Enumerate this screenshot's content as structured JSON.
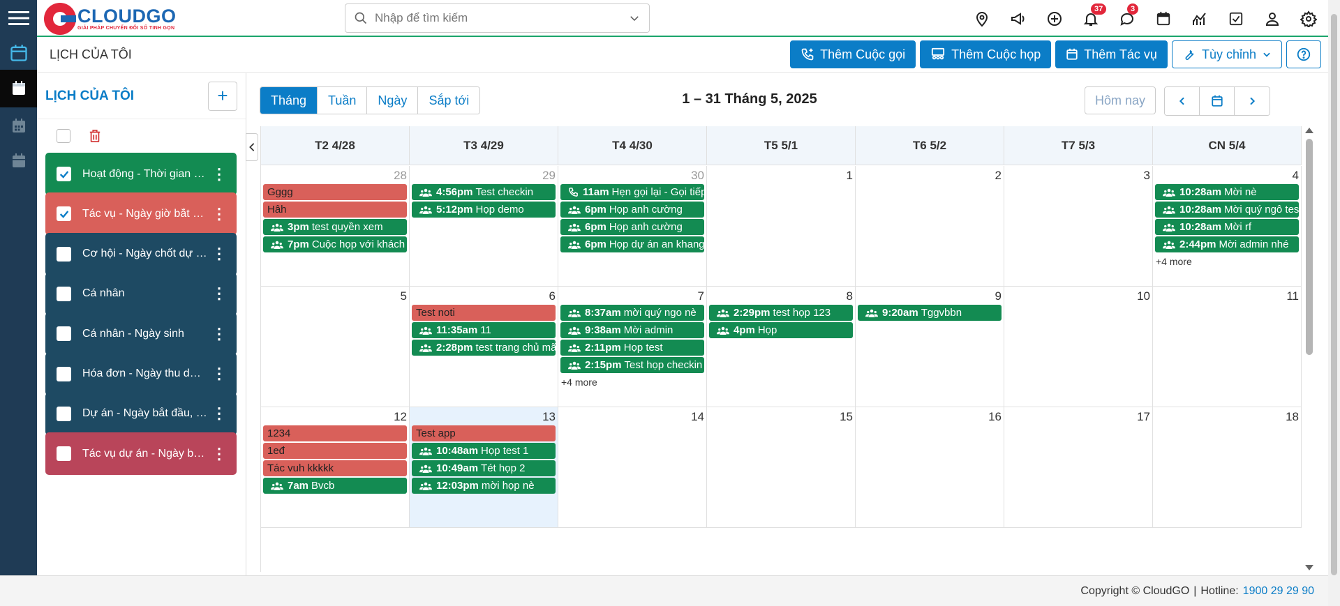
{
  "app": {
    "brand": "CLOUDGO",
    "tagline": "GIẢI PHÁP CHUYỂN ĐỔI SỐ TINH GỌN"
  },
  "search": {
    "placeholder": "Nhập để tìm kiếm"
  },
  "notifications": {
    "bell_count": "37",
    "chat_count": "3"
  },
  "page_title": "LỊCH CỦA TÔI",
  "actions": {
    "call": "Thêm Cuộc gọi",
    "meeting": "Thêm Cuộc họp",
    "task": "Thêm Tác vụ",
    "customize": "Tùy chỉnh"
  },
  "left_panel": {
    "title": "LỊCH CỦA TÔI",
    "calendars": [
      {
        "name": "Hoạt động - Thời gian bắt đầu",
        "color": "#138b52",
        "checked": true
      },
      {
        "name": "Tác vụ - Ngày giờ bắt đầu",
        "color": "#d9605a",
        "checked": true
      },
      {
        "name": "Cơ hội - Ngày chốt dự kiến",
        "color": "#1e4a63",
        "checked": false
      },
      {
        "name": "Cá nhân",
        "color": "#1e4a63",
        "checked": false
      },
      {
        "name": "Cá nhân - Ngày sinh",
        "color": "#1e4a63",
        "checked": false
      },
      {
        "name": "Hóa đơn - Ngày thu dự kiến",
        "color": "#1e4a63",
        "checked": false
      },
      {
        "name": "Dự án - Ngày bắt đầu, kết thúc",
        "color": "#1e4a63",
        "checked": false
      },
      {
        "name": "Tác vụ dự án - Ngày bắt đầu",
        "color": "#b9455a",
        "checked": false
      }
    ]
  },
  "calendar": {
    "views": [
      "Tháng",
      "Tuần",
      "Ngày",
      "Sắp tới"
    ],
    "active_view": "Tháng",
    "range_title": "1 – 31 Tháng 5, 2025",
    "today_label": "Hôm nay",
    "day_headers": [
      "T2 4/28",
      "T3 4/29",
      "T4 4/30",
      "T5 5/1",
      "T6 5/2",
      "T7 5/3",
      "CN 5/4"
    ],
    "weeks": [
      {
        "days": [
          {
            "num": "28",
            "other": true,
            "events": [
              {
                "type": "task",
                "title": "Gggg"
              },
              {
                "type": "task",
                "title": "Hâh"
              },
              {
                "type": "meet",
                "time": "3pm",
                "title": "test quyền xem"
              },
              {
                "type": "meet",
                "time": "7pm",
                "title": "Cuộc họp với khách"
              }
            ]
          },
          {
            "num": "29",
            "other": true,
            "events": [
              {
                "type": "meet",
                "time": "4:56pm",
                "title": "Test checkin"
              },
              {
                "type": "meet",
                "time": "5:12pm",
                "title": "Họp demo"
              }
            ]
          },
          {
            "num": "30",
            "other": true,
            "events": [
              {
                "type": "call",
                "time": "11am",
                "title": "Hẹn gọi lại - Gọi tiếp"
              },
              {
                "type": "meet",
                "time": "6pm",
                "title": "Họp anh cường"
              },
              {
                "type": "meet",
                "time": "6pm",
                "title": "Họp anh cường"
              },
              {
                "type": "meet",
                "time": "6pm",
                "title": "Họp dự án an khang"
              }
            ]
          },
          {
            "num": "1",
            "events": []
          },
          {
            "num": "2",
            "events": []
          },
          {
            "num": "3",
            "events": []
          },
          {
            "num": "4",
            "events": [
              {
                "type": "meet",
                "time": "10:28am",
                "title": "Mời nè"
              },
              {
                "type": "meet",
                "time": "10:28am",
                "title": "Mời quý ngô test"
              },
              {
                "type": "meet",
                "time": "10:28am",
                "title": "Mời rf"
              },
              {
                "type": "meet",
                "time": "2:44pm",
                "title": "Mời admin nhé"
              }
            ],
            "more": "+4 more"
          }
        ]
      },
      {
        "days": [
          {
            "num": "5",
            "events": []
          },
          {
            "num": "6",
            "events": [
              {
                "type": "task",
                "title": "Test noti"
              },
              {
                "type": "meet",
                "time": "11:35am",
                "title": "11"
              },
              {
                "type": "meet",
                "time": "2:28pm",
                "title": "test trang chủ mã"
              }
            ]
          },
          {
            "num": "7",
            "events": [
              {
                "type": "meet",
                "time": "8:37am",
                "title": "mời quý ngo nè"
              },
              {
                "type": "meet",
                "time": "9:38am",
                "title": "Mời admin"
              },
              {
                "type": "meet",
                "time": "2:11pm",
                "title": "Họp test"
              },
              {
                "type": "meet",
                "time": "2:15pm",
                "title": "Test họp checkin"
              }
            ],
            "more": "+4 more"
          },
          {
            "num": "8",
            "events": [
              {
                "type": "meet",
                "time": "2:29pm",
                "title": "test họp 123"
              },
              {
                "type": "meet",
                "time": "4pm",
                "title": "Họp"
              }
            ]
          },
          {
            "num": "9",
            "events": [
              {
                "type": "meet",
                "time": "9:20am",
                "title": "Tggvbbn"
              }
            ]
          },
          {
            "num": "10",
            "events": []
          },
          {
            "num": "11",
            "events": []
          }
        ]
      },
      {
        "days": [
          {
            "num": "12",
            "events": [
              {
                "type": "task",
                "title": "1234"
              },
              {
                "type": "task",
                "title": "1eđ"
              },
              {
                "type": "task",
                "title": "Tác vuh kkkkk"
              },
              {
                "type": "meet",
                "time": "7am",
                "title": "Bvcb"
              }
            ]
          },
          {
            "num": "13",
            "today": true,
            "events": [
              {
                "type": "task",
                "title": "Test app"
              },
              {
                "type": "meet",
                "time": "10:48am",
                "title": "Họp test 1"
              },
              {
                "type": "meet",
                "time": "10:49am",
                "title": "Tét họp 2"
              },
              {
                "type": "meet",
                "time": "12:03pm",
                "title": "mời họp nè"
              }
            ]
          },
          {
            "num": "14",
            "events": []
          },
          {
            "num": "15",
            "events": []
          },
          {
            "num": "16",
            "events": []
          },
          {
            "num": "17",
            "events": []
          },
          {
            "num": "18",
            "events": []
          }
        ]
      }
    ]
  },
  "footer": {
    "copyright": "Copyright © CloudGO",
    "hotline_label": "Hotline:",
    "hotline": "1900 29 29 90"
  },
  "colors": {
    "primary": "#0b7dc7",
    "meeting": "#138b52",
    "task": "#d9605a",
    "rail": "#1f3b55",
    "today": "#e7f2fd"
  }
}
